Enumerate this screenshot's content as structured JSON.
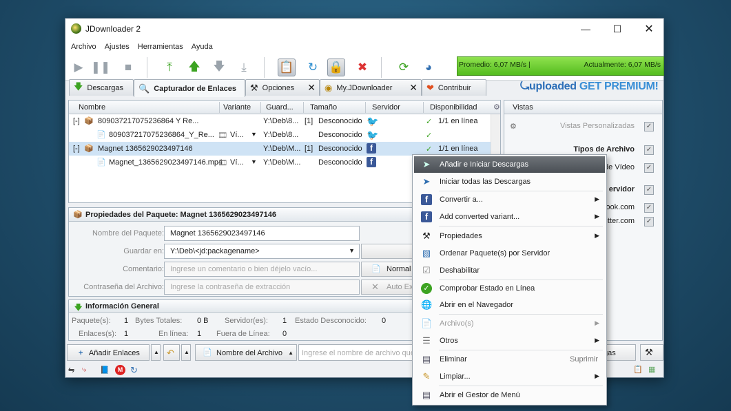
{
  "window": {
    "title": "JDownloader 2"
  },
  "menu": [
    "Archivo",
    "Ajustes",
    "Herramientas",
    "Ayuda"
  ],
  "speed": {
    "average": "Promedio: 6,07 MB/s |",
    "current": "Actualmente: 6,07 MB/s"
  },
  "tabs": [
    {
      "label": "Descargas"
    },
    {
      "label": "Capturador de Enlaces"
    },
    {
      "label": "Opciones"
    },
    {
      "label": "My.JDownloader"
    },
    {
      "label": "Contribuir"
    }
  ],
  "premium": {
    "brand": "uploaded",
    "cta": "GET PREMIUM!"
  },
  "table": {
    "columns": [
      "Nombre",
      "Variante",
      "Guard...",
      "Tamaño",
      "Servidor",
      "Disponibilidad"
    ],
    "rows": [
      {
        "toggle": "[-]",
        "name": "809037217075236864 Y Re...",
        "variant": "",
        "save": "Y:\\Deb\\8...",
        "count": "[1]",
        "size": "Desconocido",
        "host": "twitter",
        "avail": "1/1 en línea"
      },
      {
        "toggle": "",
        "name": "809037217075236864_Y_Re...",
        "variant": "Ví...",
        "save": "Y:\\Deb\\8...",
        "count": "",
        "size": "Desconocido",
        "host": "twitter",
        "avail": ""
      },
      {
        "toggle": "[-]",
        "name": "Magnet 1365629023497146",
        "variant": "",
        "save": "Y:\\Deb\\M...",
        "count": "[1]",
        "size": "Desconocido",
        "host": "facebook",
        "avail": "1/1 en línea"
      },
      {
        "toggle": "",
        "name": "Magnet_1365629023497146.mp4",
        "variant": "Ví...",
        "save": "Y:\\Deb\\M...",
        "count": "",
        "size": "Desconocido",
        "host": "facebook",
        "avail": ""
      }
    ]
  },
  "views": {
    "header": "Vistas",
    "items": [
      "Vistas Personalizadas",
      "Tipos de Archivo",
      "de Vídeo",
      "ervidor",
      "ook.com",
      "itter.com"
    ]
  },
  "props": {
    "header": "Propiedades del Paquete: Magnet 1365629023497146",
    "labels": {
      "name": "Nombre del Paquete:",
      "save": "Guardar en:",
      "comment": "Comentario:",
      "password": "Contraseña del Archivo:"
    },
    "name_value": "Magnet 1365629023497146",
    "save_value": "Y:\\Deb\\<jd:packagename>",
    "comment_placeholder": "Ingrese un comentario o bien déjelo vacío...",
    "password_placeholder": "Ingrese la contraseña de extracción",
    "normal_btn": "Normal",
    "autoex_btn": "Auto Ex"
  },
  "info": {
    "header": "Información General",
    "packages_label": "Paquete(s):",
    "packages": "1",
    "bytes_label": "Bytes Totales:",
    "bytes": "0 B",
    "servers_label": "Servidor(es):",
    "servers": "1",
    "unknown_label": "Estado Desconocido:",
    "unknown": "0",
    "links_label": "Enlaces(s):",
    "links": "1",
    "online_label": "En línea:",
    "online": "1",
    "offline_label": "Fuera de Línea:",
    "offline": "0"
  },
  "bottom": {
    "add_links": "Añadir Enlaces",
    "filename": "Nombre del Archivo",
    "search_placeholder": "Ingrese el nombre de archivo que",
    "right_btn": "gas"
  },
  "context_menu": [
    {
      "label": "Añadir e Iniciar Descargas",
      "highlight": true
    },
    {
      "label": "Iniciar todas las Descargas"
    },
    {
      "label": "Convertir a...",
      "submenu": true
    },
    {
      "label": "Add converted variant...",
      "submenu": true
    },
    {
      "label": "Propiedades",
      "submenu": true
    },
    {
      "label": "Ordenar Paquete(s) por Servidor"
    },
    {
      "label": "Deshabilitar"
    },
    {
      "label": "Comprobar Estado en Línea"
    },
    {
      "label": "Abrir en el Navegador"
    },
    {
      "label": "Archivo(s)",
      "submenu": true,
      "disabled": true
    },
    {
      "label": "Otros",
      "submenu": true
    },
    {
      "label": "Eliminar",
      "shortcut": "Suprimir"
    },
    {
      "label": "Limpiar...",
      "submenu": true
    },
    {
      "label": "Abrir el Gestor de Menú"
    }
  ]
}
